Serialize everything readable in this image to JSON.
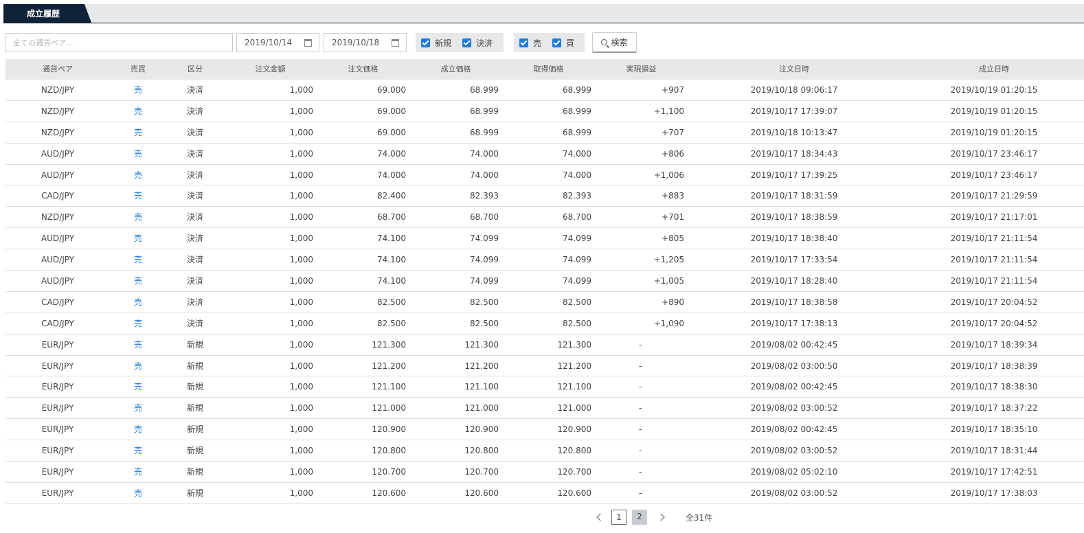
{
  "tab": {
    "label": "成立履歴"
  },
  "filter": {
    "pair_placeholder": "全ての通貨ペア...",
    "date_from": "2019/10/14",
    "date_to": "2019/10/18",
    "kind_new_label": "新規",
    "kind_settle_label": "決済",
    "side_sell_label": "売",
    "side_buy_label": "買",
    "search_label": "検索",
    "accent_color": "#1f7bd8"
  },
  "table": {
    "headers": {
      "pair": "通貨ペア",
      "side": "売買",
      "kind": "区分",
      "amount": "注文金額",
      "order_price": "注文価格",
      "fill_price": "成立価格",
      "acq_price": "取得価格",
      "pl": "実現損益",
      "order_time": "注文日時",
      "fill_time": "成立日時"
    },
    "rows": [
      {
        "pair": "NZD/JPY",
        "side": "売",
        "kind": "決済",
        "amount": "1,000",
        "order_price": "69.000",
        "fill_price": "68.999",
        "acq_price": "68.999",
        "pl": "+907",
        "order_time": "2019/10/18 09:06:17",
        "fill_time": "2019/10/19 01:20:15"
      },
      {
        "pair": "NZD/JPY",
        "side": "売",
        "kind": "決済",
        "amount": "1,000",
        "order_price": "69.000",
        "fill_price": "68.999",
        "acq_price": "68.999",
        "pl": "+1,100",
        "order_time": "2019/10/17 17:39:07",
        "fill_time": "2019/10/19 01:20:15"
      },
      {
        "pair": "NZD/JPY",
        "side": "売",
        "kind": "決済",
        "amount": "1,000",
        "order_price": "69.000",
        "fill_price": "68.999",
        "acq_price": "68.999",
        "pl": "+707",
        "order_time": "2019/10/18 10:13:47",
        "fill_time": "2019/10/19 01:20:15"
      },
      {
        "pair": "AUD/JPY",
        "side": "売",
        "kind": "決済",
        "amount": "1,000",
        "order_price": "74.000",
        "fill_price": "74.000",
        "acq_price": "74.000",
        "pl": "+806",
        "order_time": "2019/10/17 18:34:43",
        "fill_time": "2019/10/17 23:46:17"
      },
      {
        "pair": "AUD/JPY",
        "side": "売",
        "kind": "決済",
        "amount": "1,000",
        "order_price": "74.000",
        "fill_price": "74.000",
        "acq_price": "74.000",
        "pl": "+1,006",
        "order_time": "2019/10/17 17:39:25",
        "fill_time": "2019/10/17 23:46:17"
      },
      {
        "pair": "CAD/JPY",
        "side": "売",
        "kind": "決済",
        "amount": "1,000",
        "order_price": "82.400",
        "fill_price": "82.393",
        "acq_price": "82.393",
        "pl": "+883",
        "order_time": "2019/10/17 18:31:59",
        "fill_time": "2019/10/17 21:29:59"
      },
      {
        "pair": "NZD/JPY",
        "side": "売",
        "kind": "決済",
        "amount": "1,000",
        "order_price": "68.700",
        "fill_price": "68.700",
        "acq_price": "68.700",
        "pl": "+701",
        "order_time": "2019/10/17 18:38:59",
        "fill_time": "2019/10/17 21:17:01"
      },
      {
        "pair": "AUD/JPY",
        "side": "売",
        "kind": "決済",
        "amount": "1,000",
        "order_price": "74.100",
        "fill_price": "74.099",
        "acq_price": "74.099",
        "pl": "+805",
        "order_time": "2019/10/17 18:38:40",
        "fill_time": "2019/10/17 21:11:54"
      },
      {
        "pair": "AUD/JPY",
        "side": "売",
        "kind": "決済",
        "amount": "1,000",
        "order_price": "74.100",
        "fill_price": "74.099",
        "acq_price": "74.099",
        "pl": "+1,205",
        "order_time": "2019/10/17 17:33:54",
        "fill_time": "2019/10/17 21:11:54"
      },
      {
        "pair": "AUD/JPY",
        "side": "売",
        "kind": "決済",
        "amount": "1,000",
        "order_price": "74.100",
        "fill_price": "74.099",
        "acq_price": "74.099",
        "pl": "+1,005",
        "order_time": "2019/10/17 18:28:40",
        "fill_time": "2019/10/17 21:11:54"
      },
      {
        "pair": "CAD/JPY",
        "side": "売",
        "kind": "決済",
        "amount": "1,000",
        "order_price": "82.500",
        "fill_price": "82.500",
        "acq_price": "82.500",
        "pl": "+890",
        "order_time": "2019/10/17 18:38:58",
        "fill_time": "2019/10/17 20:04:52"
      },
      {
        "pair": "CAD/JPY",
        "side": "売",
        "kind": "決済",
        "amount": "1,000",
        "order_price": "82.500",
        "fill_price": "82.500",
        "acq_price": "82.500",
        "pl": "+1,090",
        "order_time": "2019/10/17 17:38:13",
        "fill_time": "2019/10/17 20:04:52"
      },
      {
        "pair": "EUR/JPY",
        "side": "売",
        "kind": "新規",
        "amount": "1,000",
        "order_price": "121.300",
        "fill_price": "121.300",
        "acq_price": "121.300",
        "pl": "-",
        "order_time": "2019/08/02 00:42:45",
        "fill_time": "2019/10/17 18:39:34"
      },
      {
        "pair": "EUR/JPY",
        "side": "売",
        "kind": "新規",
        "amount": "1,000",
        "order_price": "121.200",
        "fill_price": "121.200",
        "acq_price": "121.200",
        "pl": "-",
        "order_time": "2019/08/02 03:00:50",
        "fill_time": "2019/10/17 18:38:39"
      },
      {
        "pair": "EUR/JPY",
        "side": "売",
        "kind": "新規",
        "amount": "1,000",
        "order_price": "121.100",
        "fill_price": "121.100",
        "acq_price": "121.100",
        "pl": "-",
        "order_time": "2019/08/02 00:42:45",
        "fill_time": "2019/10/17 18:38:30"
      },
      {
        "pair": "EUR/JPY",
        "side": "売",
        "kind": "新規",
        "amount": "1,000",
        "order_price": "121.000",
        "fill_price": "121.000",
        "acq_price": "121.000",
        "pl": "-",
        "order_time": "2019/08/02 03:00:52",
        "fill_time": "2019/10/17 18:37:22"
      },
      {
        "pair": "EUR/JPY",
        "side": "売",
        "kind": "新規",
        "amount": "1,000",
        "order_price": "120.900",
        "fill_price": "120.900",
        "acq_price": "120.900",
        "pl": "-",
        "order_time": "2019/08/02 00:42:45",
        "fill_time": "2019/10/17 18:35:10"
      },
      {
        "pair": "EUR/JPY",
        "side": "売",
        "kind": "新規",
        "amount": "1,000",
        "order_price": "120.800",
        "fill_price": "120.800",
        "acq_price": "120.800",
        "pl": "-",
        "order_time": "2019/08/02 03:00:52",
        "fill_time": "2019/10/17 18:31:44"
      },
      {
        "pair": "EUR/JPY",
        "side": "売",
        "kind": "新規",
        "amount": "1,000",
        "order_price": "120.700",
        "fill_price": "120.700",
        "acq_price": "120.700",
        "pl": "-",
        "order_time": "2019/08/02 05:02:10",
        "fill_time": "2019/10/17 17:42:51"
      },
      {
        "pair": "EUR/JPY",
        "side": "売",
        "kind": "新規",
        "amount": "1,000",
        "order_price": "120.600",
        "fill_price": "120.600",
        "acq_price": "120.600",
        "pl": "-",
        "order_time": "2019/08/02 03:00:52",
        "fill_time": "2019/10/17 17:38:03"
      }
    ]
  },
  "pagination": {
    "pages": [
      "1",
      "2"
    ],
    "current_page": "1",
    "total_label": "全31件"
  }
}
